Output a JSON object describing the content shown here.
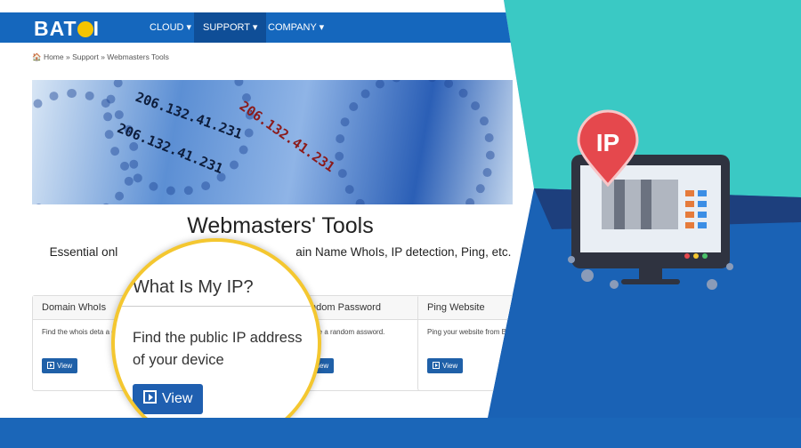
{
  "logo": {
    "text_before": "BAT",
    "text_after": "I"
  },
  "nav": {
    "cloud": "CLOUD ▾",
    "support": "SUPPORT ▾",
    "company": "COMPANY ▾"
  },
  "breadcrumb": "🏠 Home » Support » Webmasters Tools",
  "banner_digits": [
    "206.132.41.231",
    "206.132.41.231",
    "206.132.41.231"
  ],
  "page": {
    "title": "Webmasters' Tools",
    "subtitle": "Essential onl",
    "subtitle_end": "ain Name WhoIs, IP detection, Ping, etc."
  },
  "cards": [
    {
      "title": "Domain WhoIs",
      "text": "Find the whois deta a domain name.",
      "button": "View"
    },
    {
      "title": "Random Password",
      "text": "enerate a random assword.",
      "button": "View"
    },
    {
      "title": "Ping Website",
      "text": "Ping your website from Batoi Cloud.",
      "button": "View"
    }
  ],
  "magnifier": {
    "title": "What Is My IP?",
    "text": "Find the public IP address of your device",
    "button": "View"
  },
  "illustration": {
    "pin_label": "IP"
  },
  "colors": {
    "brand_blue": "#1567bd",
    "teal": "#3ac9c4",
    "accent_yellow": "#f4c730",
    "pin_red": "#e5484d"
  }
}
